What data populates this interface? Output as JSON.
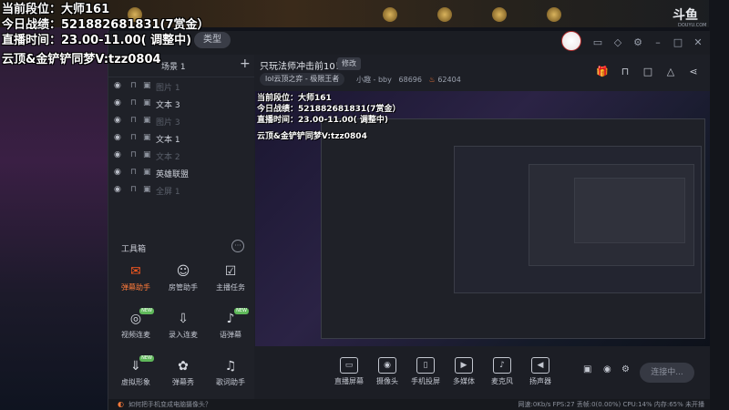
{
  "overlay": {
    "line1": "当前段位：大师161",
    "line2": "今日战绩：521882681831(7赏金）",
    "line3": "直播时间：23.00-11.00( 调整中)",
    "line4": "云顶&金铲铲同梦V:tzz0804"
  },
  "watermark": {
    "brand": "斗鱼",
    "sub": "DOUYU.COM"
  },
  "titlebar": {
    "type_label": "类型"
  },
  "scene": {
    "tab_label": "场景 1",
    "rows": [
      {
        "label": "图片 1",
        "state": "dim"
      },
      {
        "label": "文本 3",
        "state": "on"
      },
      {
        "label": "图片 3",
        "state": "dim"
      },
      {
        "label": "文本 1",
        "state": "on"
      },
      {
        "label": "文本 2",
        "state": "dim"
      },
      {
        "label": "英雄联盟",
        "state": "on"
      },
      {
        "label": "全屏 1",
        "state": "dim"
      }
    ]
  },
  "toolbox": {
    "title": "工具箱",
    "tools": [
      {
        "label": "弹幕助手",
        "icon": "chat-icon",
        "glyph": "✉",
        "active": true,
        "badge": ""
      },
      {
        "label": "房管助手",
        "icon": "person-icon",
        "glyph": "☺",
        "active": false,
        "badge": ""
      },
      {
        "label": "主播任务",
        "icon": "task-icon",
        "glyph": "☑",
        "active": false,
        "badge": ""
      },
      {
        "label": "视频连麦",
        "icon": "video-link-icon",
        "glyph": "◎",
        "active": false,
        "badge": "NEW"
      },
      {
        "label": "录入连麦",
        "icon": "record-icon",
        "glyph": "⇩",
        "active": false,
        "badge": ""
      },
      {
        "label": "语弹幕",
        "icon": "voice-danmu-icon",
        "glyph": "♪",
        "active": false,
        "badge": "NEW"
      },
      {
        "label": "虚拟形象",
        "icon": "avatar-icon",
        "glyph": "⇓",
        "active": false,
        "badge": "NEW"
      },
      {
        "label": "弹幕秀",
        "icon": "danmu-show-icon",
        "glyph": "✿",
        "active": false,
        "badge": ""
      },
      {
        "label": "歌词助手",
        "icon": "lyrics-icon",
        "glyph": "♫",
        "active": false,
        "badge": ""
      }
    ]
  },
  "stream": {
    "title": "只玩法师冲击前10！",
    "modify_label": "修改",
    "category": "lol云顶之弈 - 极限王者",
    "streamer": "小趣 - bby",
    "count1": "68696",
    "count2": "62404"
  },
  "controls": [
    {
      "label": "直播屏幕",
      "glyph": "▭"
    },
    {
      "label": "摄像头",
      "glyph": "◉"
    },
    {
      "label": "手机投屏",
      "glyph": "▯"
    },
    {
      "label": "多媒体",
      "glyph": "▶"
    },
    {
      "label": "麦克风",
      "glyph": "♪"
    },
    {
      "label": "扬声器",
      "glyph": "◀"
    }
  ],
  "start_label": "连接中...",
  "hint": "如何把手机变成电脑摄像头？",
  "status": "网速:0Kb/s   FPS:27   丢帧:0(0.00%)   CPU:14%   内存:65%   未开播"
}
